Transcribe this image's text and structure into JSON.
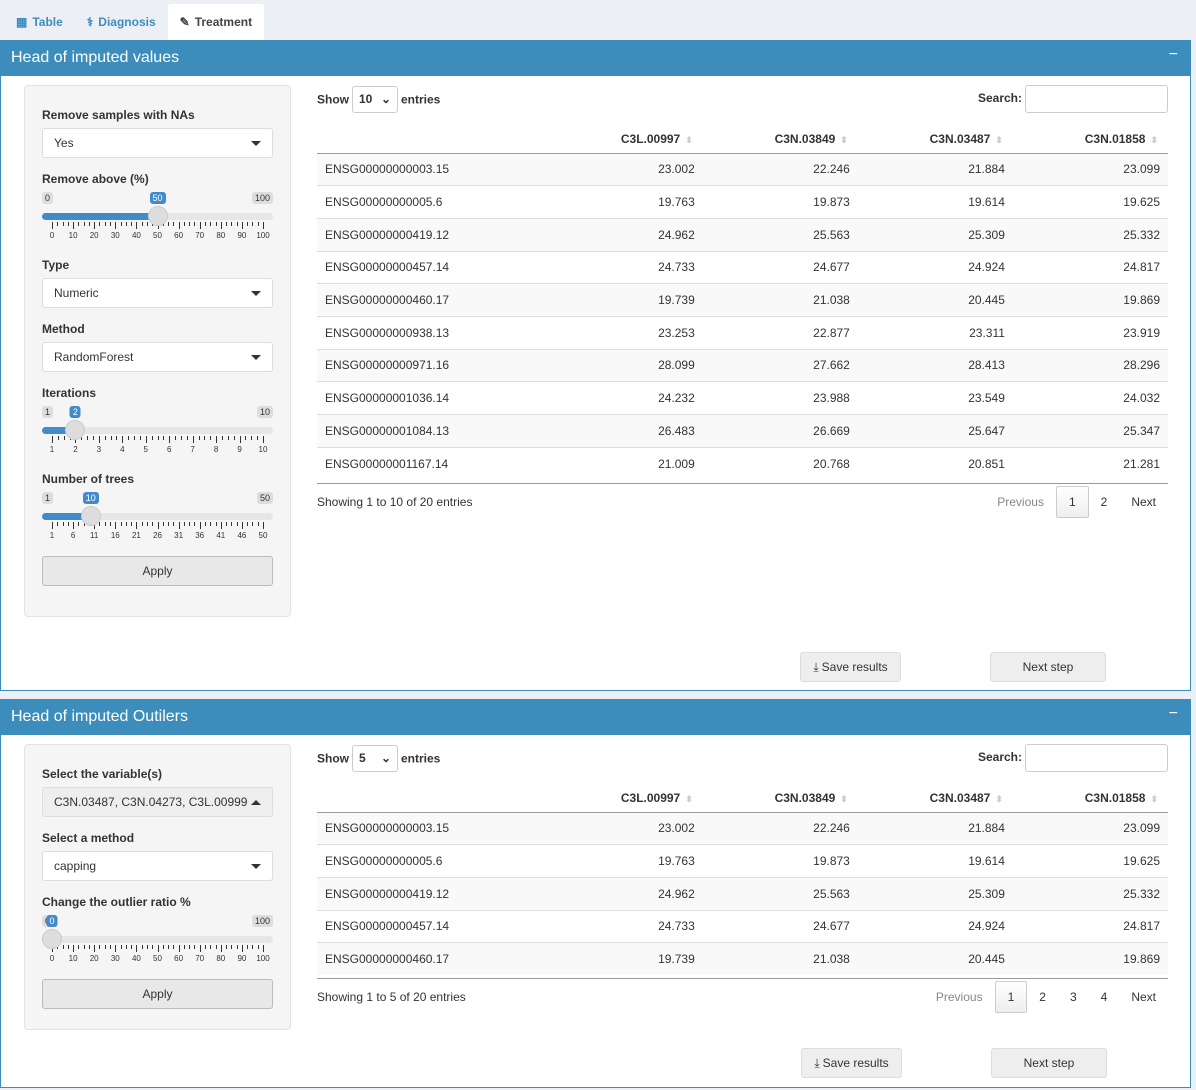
{
  "tabs": [
    {
      "label": "Table",
      "icon": "table-icon"
    },
    {
      "label": "Diagnosis",
      "icon": "stethoscope-icon"
    },
    {
      "label": "Treatment",
      "icon": "syringe-icon",
      "active": true
    }
  ],
  "box1": {
    "title": "Head of imputed values",
    "minimize": "−",
    "sidebar": {
      "na_label": "Remove samples with NAs",
      "na_value": "Yes",
      "remove_label": "Remove above (%)",
      "remove_slider": {
        "min": 0,
        "max": 100,
        "value": 50,
        "ticks": [
          "0",
          "10",
          "20",
          "30",
          "40",
          "50",
          "60",
          "70",
          "80",
          "90",
          "100"
        ]
      },
      "type_label": "Type",
      "type_value": "Numeric",
      "method_label": "Method",
      "method_value": "RandomForest",
      "iter_label": "Iterations",
      "iter_slider": {
        "min": 1,
        "max": 10,
        "value": 2,
        "ticks": [
          "1",
          "2",
          "3",
          "4",
          "5",
          "6",
          "7",
          "8",
          "9",
          "10"
        ]
      },
      "trees_label": "Number of trees",
      "trees_slider": {
        "min": 1,
        "max": 50,
        "value": 10,
        "ticks": [
          "1",
          "6",
          "11",
          "16",
          "21",
          "26",
          "31",
          "36",
          "41",
          "46",
          "50"
        ]
      },
      "apply": "Apply"
    },
    "table": {
      "show": "Show",
      "length": "10",
      "entries": "entries",
      "search": "Search:",
      "columns": [
        "",
        "C3L.00997",
        "C3N.03849",
        "C3N.03487",
        "C3N.01858"
      ],
      "rows": [
        [
          "ENSG00000000003.15",
          "23.002",
          "22.246",
          "21.884",
          "23.099"
        ],
        [
          "ENSG00000000005.6",
          "19.763",
          "19.873",
          "19.614",
          "19.625"
        ],
        [
          "ENSG00000000419.12",
          "24.962",
          "25.563",
          "25.309",
          "25.332"
        ],
        [
          "ENSG00000000457.14",
          "24.733",
          "24.677",
          "24.924",
          "24.817"
        ],
        [
          "ENSG00000000460.17",
          "19.739",
          "21.038",
          "20.445",
          "19.869"
        ],
        [
          "ENSG00000000938.13",
          "23.253",
          "22.877",
          "23.311",
          "23.919"
        ],
        [
          "ENSG00000000971.16",
          "28.099",
          "27.662",
          "28.413",
          "28.296"
        ],
        [
          "ENSG00000001036.14",
          "24.232",
          "23.988",
          "23.549",
          "24.032"
        ],
        [
          "ENSG00000001084.13",
          "26.483",
          "26.669",
          "25.647",
          "25.347"
        ],
        [
          "ENSG00000001167.14",
          "21.009",
          "20.768",
          "20.851",
          "21.281"
        ]
      ],
      "info": "Showing 1 to 10 of 20 entries",
      "previous": "Previous",
      "pages": [
        "1",
        "2"
      ],
      "current": "1",
      "next": "Next"
    },
    "save": "Save results",
    "next_step": "Next step"
  },
  "box2": {
    "title": "Head of imputed Outilers",
    "minimize": "−",
    "sidebar": {
      "var_label": "Select the variable(s)",
      "var_value": "C3N.03487, C3N.04273, C3L.00999",
      "method_label": "Select a method",
      "method_value": "capping",
      "ratio_label": "Change the outlier ratio %",
      "ratio_slider": {
        "min": 0,
        "max": 100,
        "value": 0,
        "ticks": [
          "0",
          "10",
          "20",
          "30",
          "40",
          "50",
          "60",
          "70",
          "80",
          "90",
          "100"
        ]
      },
      "apply": "Apply"
    },
    "table": {
      "show": "Show",
      "length": "5",
      "entries": "entries",
      "search": "Search:",
      "columns": [
        "",
        "C3L.00997",
        "C3N.03849",
        "C3N.03487",
        "C3N.01858"
      ],
      "rows": [
        [
          "ENSG00000000003.15",
          "23.002",
          "22.246",
          "21.884",
          "23.099"
        ],
        [
          "ENSG00000000005.6",
          "19.763",
          "19.873",
          "19.614",
          "19.625"
        ],
        [
          "ENSG00000000419.12",
          "24.962",
          "25.563",
          "25.309",
          "25.332"
        ],
        [
          "ENSG00000000457.14",
          "24.733",
          "24.677",
          "24.924",
          "24.817"
        ],
        [
          "ENSG00000000460.17",
          "19.739",
          "21.038",
          "20.445",
          "19.869"
        ]
      ],
      "info": "Showing 1 to 5 of 20 entries",
      "previous": "Previous",
      "pages": [
        "1",
        "2",
        "3",
        "4"
      ],
      "current": "1",
      "next": "Next"
    },
    "save": "Save results",
    "next_step": "Next step"
  },
  "colors": {
    "primary": "#3c8dbc",
    "slider": "#428bca",
    "background": "#ecf0f5"
  }
}
